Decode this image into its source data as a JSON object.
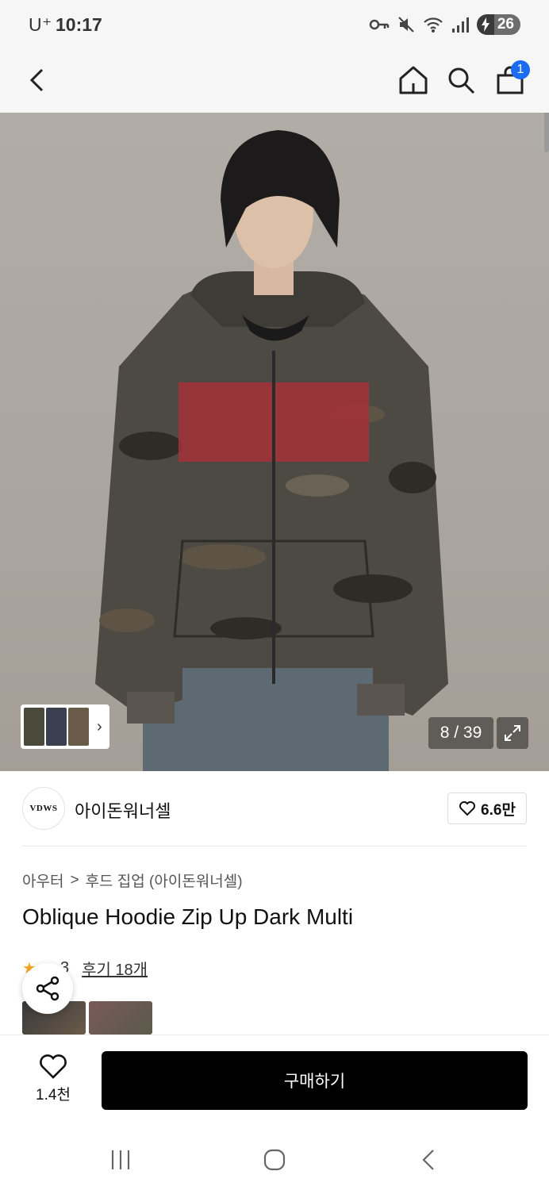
{
  "status_bar": {
    "carrier": "U⁺",
    "time": "10:17",
    "battery": "26"
  },
  "nav": {
    "cart_count": "1"
  },
  "gallery": {
    "counter": "8 / 39"
  },
  "brand": {
    "logo_text": "VDWS",
    "name": "아이돈워너셀",
    "likes": "6.6만"
  },
  "breadcrumb": {
    "category": "아우터",
    "separator": ">",
    "subcategory": "후드 집업 (아이돈워너셀)"
  },
  "product": {
    "title": "Oblique Hoodie Zip Up Dark Multi",
    "rating_fragment": "3",
    "review_link": "후기 18개"
  },
  "actions": {
    "wish_count": "1.4천",
    "buy_label": "구매하기"
  },
  "colors": {
    "accent": "#1b6cf2",
    "star": "#f5a623",
    "buy_button": "#000000"
  }
}
